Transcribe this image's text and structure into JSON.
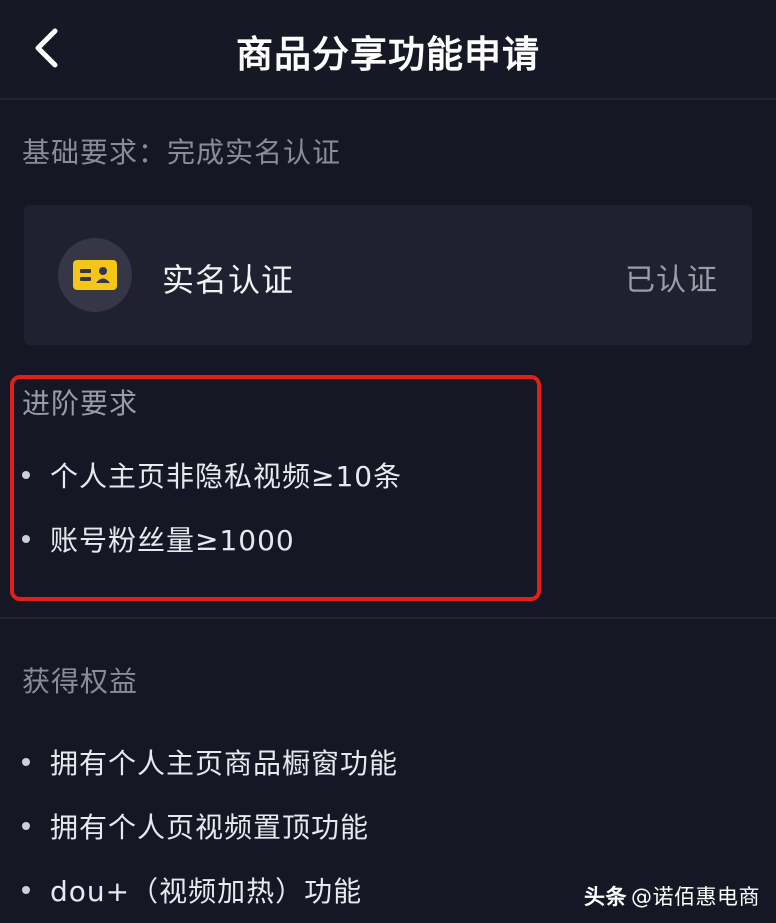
{
  "header": {
    "back_icon": "chevron-left-icon",
    "title": "商品分享功能申请"
  },
  "basic": {
    "label": "基础要求：完成实名认证",
    "card": {
      "icon": "id-card-icon",
      "icon_color": "#f5c518",
      "label": "实名认证",
      "status": "已认证"
    }
  },
  "advanced": {
    "label": "进阶要求",
    "highlight_color": "#e51e19",
    "items": [
      "个人主页非隐私视频≥10条",
      "账号粉丝量≥1000"
    ]
  },
  "benefits": {
    "label": "获得权益",
    "items": [
      "拥有个人主页商品橱窗功能",
      "拥有个人页视频置顶功能",
      "dou+（视频加热）功能"
    ]
  },
  "watermark": {
    "brand": "头条",
    "account": "@诺佰惠电商"
  }
}
